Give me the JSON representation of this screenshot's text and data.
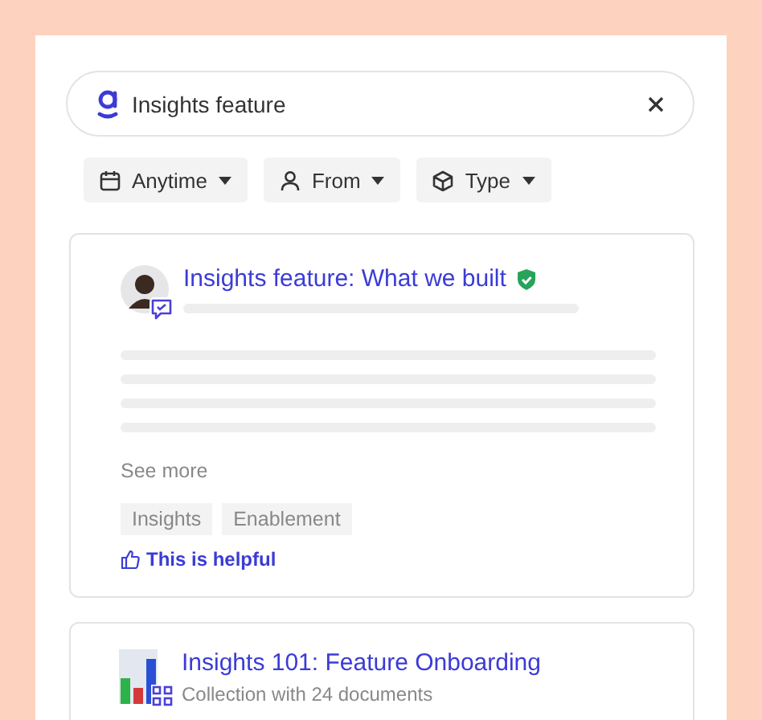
{
  "search": {
    "value": "Insights feature"
  },
  "filters": [
    {
      "label": "Anytime",
      "kind": "calendar"
    },
    {
      "label": "From",
      "kind": "person"
    },
    {
      "label": "Type",
      "kind": "cube"
    }
  ],
  "results": [
    {
      "kind": "post",
      "title": "Insights feature: What we built",
      "verified": true,
      "see_more": "See more",
      "tags": [
        "Insights",
        "Enablement"
      ],
      "helpful": "This is helpful"
    },
    {
      "kind": "collection",
      "title": "Insights 101: Feature Onboarding",
      "subtitle": "Collection with 24 documents"
    }
  ]
}
